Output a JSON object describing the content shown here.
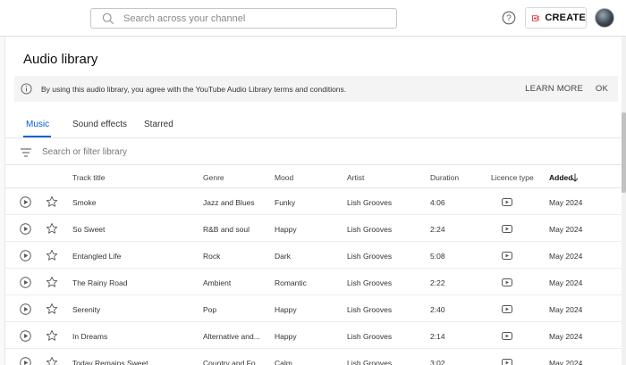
{
  "header": {
    "search_placeholder": "Search across your channel",
    "create_label": "CREATE"
  },
  "page": {
    "title": "Audio library"
  },
  "notice": {
    "text": "By using this audio library, you agree with the YouTube Audio Library terms and conditions.",
    "learn_more": "LEARN MORE",
    "ok": "OK"
  },
  "tabs": [
    {
      "label": "Music",
      "active": true
    },
    {
      "label": "Sound effects",
      "active": false
    },
    {
      "label": "Starred",
      "active": false
    }
  ],
  "filter": {
    "placeholder": "Search or filter library"
  },
  "columns": {
    "track_title": "Track title",
    "genre": "Genre",
    "mood": "Mood",
    "artist": "Artist",
    "duration": "Duration",
    "licence_type": "Licence type",
    "added": "Added"
  },
  "tracks": [
    {
      "title": "Smoke",
      "genre": "Jazz and Blues",
      "mood": "Funky",
      "artist": "Lish Grooves",
      "duration": "4:06",
      "added": "May 2024"
    },
    {
      "title": "So Sweet",
      "genre": "R&B and soul",
      "mood": "Happy",
      "artist": "Lish Grooves",
      "duration": "2:24",
      "added": "May 2024"
    },
    {
      "title": "Entangled Life",
      "genre": "Rock",
      "mood": "Dark",
      "artist": "Lish Grooves",
      "duration": "5:08",
      "added": "May 2024"
    },
    {
      "title": "The Rainy Road",
      "genre": "Ambient",
      "mood": "Romantic",
      "artist": "Lish Grooves",
      "duration": "2:22",
      "added": "May 2024"
    },
    {
      "title": "Serenity",
      "genre": "Pop",
      "mood": "Happy",
      "artist": "Lish Grooves",
      "duration": "2:40",
      "added": "May 2024"
    },
    {
      "title": "In Dreams",
      "genre": "Alternative and...",
      "mood": "Happy",
      "artist": "Lish Grooves",
      "duration": "2:14",
      "added": "May 2024"
    },
    {
      "title": "Today Remains Sweet",
      "genre": "Country and Fo...",
      "mood": "Calm",
      "artist": "Lish Grooves",
      "duration": "3:02",
      "added": "May 2024"
    }
  ],
  "icons": {
    "search": "search-icon",
    "help": "help-icon",
    "create": "video-camera-plus-icon",
    "info": "info-icon",
    "filter": "filter-icon",
    "play": "play-icon",
    "star": "star-outline-icon",
    "licence": "youtube-licence-icon",
    "sort": "arrow-down-icon"
  },
  "colors": {
    "accent": "#065fd4",
    "create_icon": "#cc0000"
  }
}
